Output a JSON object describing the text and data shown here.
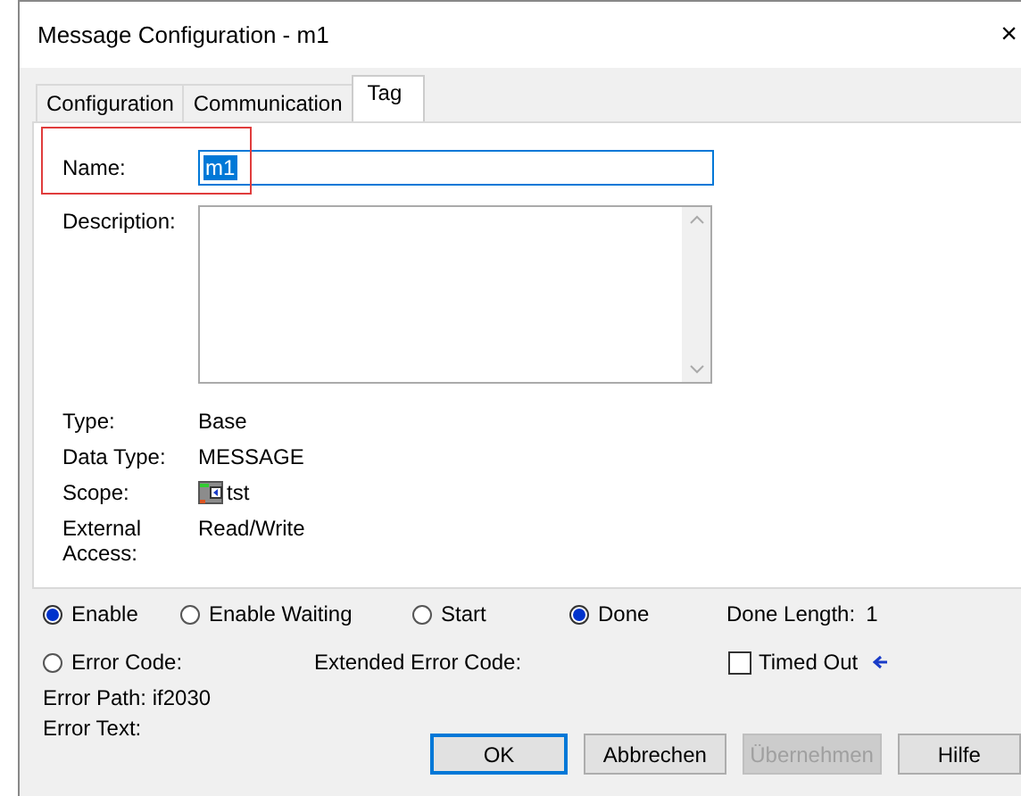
{
  "window": {
    "title": "Message Configuration - m1",
    "close": "×"
  },
  "tabs": [
    {
      "label": "Configuration",
      "selected": false
    },
    {
      "label": "Communication",
      "selected": false
    },
    {
      "label": "Tag",
      "selected": true
    }
  ],
  "name": {
    "label": "Name:",
    "value": "m1",
    "text_selected": true,
    "highlighted": true
  },
  "description": {
    "label": "Description:"
  },
  "properties": [
    {
      "label": "Type:",
      "value": "Base",
      "kind": "plain"
    },
    {
      "label": "Data Type:",
      "value": "MESSAGE",
      "kind": "plain"
    },
    {
      "label": "Scope:",
      "value": "tst",
      "kind": "icon"
    },
    {
      "label": "External Access:",
      "value": "Read/Write",
      "kind": "plain"
    }
  ],
  "status": [
    {
      "label": "Enable",
      "on": true
    },
    {
      "label": "Enable Waiting",
      "on": false
    },
    {
      "label": "Start",
      "on": false
    },
    {
      "label": "Done",
      "on": true
    }
  ],
  "done_length": {
    "label": "Done Length:",
    "value": "1"
  },
  "error_code": {
    "label": "Error Code:",
    "on": false
  },
  "extended_error_code": {
    "label": "Extended Error Code:"
  },
  "timed_out": {
    "label": "Timed Out",
    "checked": false
  },
  "error_path": "Error Path: if2030",
  "error_text": "Error Text:",
  "buttons": [
    {
      "label": "OK",
      "default": true,
      "disabled": false
    },
    {
      "label": "Abbrechen",
      "default": false,
      "disabled": false
    },
    {
      "label": "Übernehmen",
      "default": false,
      "disabled": true
    },
    {
      "label": "Hilfe",
      "default": false,
      "disabled": false
    }
  ]
}
